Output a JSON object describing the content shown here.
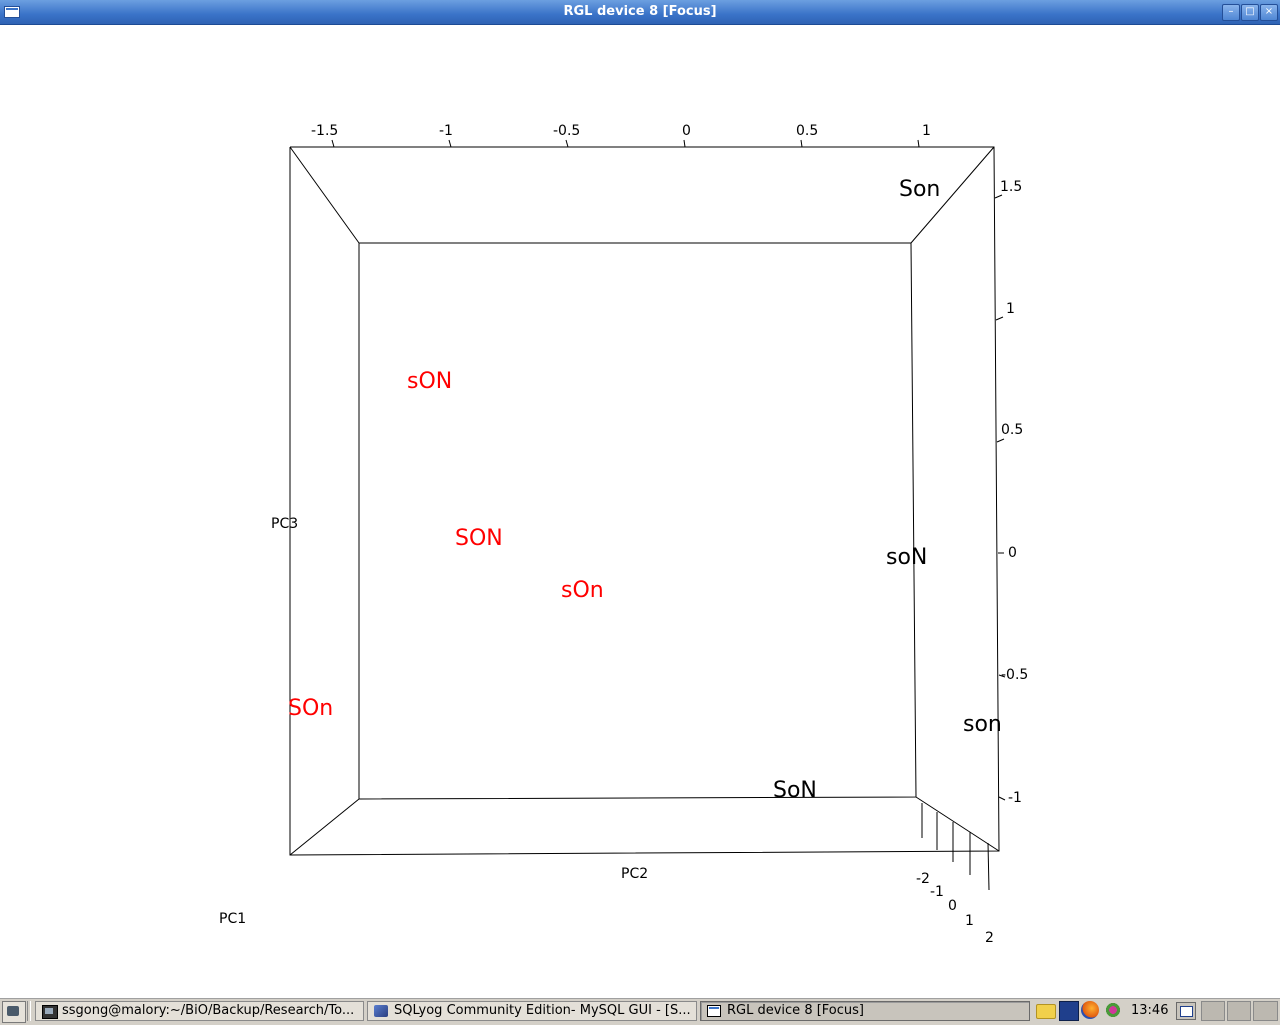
{
  "window": {
    "title": "RGL device 8 [Focus]",
    "buttons": {
      "minimize": "–",
      "maximize": "□",
      "close": "×"
    }
  },
  "plot": {
    "axes": {
      "pc1_label": "PC1",
      "pc2_label": "PC2",
      "pc3_label": "PC3",
      "top_ticks": [
        "-1.5",
        "-1",
        "-0.5",
        "0",
        "0.5",
        "1"
      ],
      "right_ticks": [
        "1.5",
        "1",
        "0.5",
        "0",
        "-0.5",
        "-1"
      ],
      "depth_ticks": [
        "-2",
        "-1",
        "0",
        "1",
        "2"
      ]
    },
    "points": [
      {
        "label": "Son",
        "color": "#000000"
      },
      {
        "label": "sON",
        "color": "#ff0000"
      },
      {
        "label": "SON",
        "color": "#ff0000"
      },
      {
        "label": "sOn",
        "color": "#ff0000"
      },
      {
        "label": "soN",
        "color": "#000000"
      },
      {
        "label": "SOn",
        "color": "#ff0000"
      },
      {
        "label": "son",
        "color": "#000000"
      },
      {
        "label": "SoN",
        "color": "#000000"
      }
    ]
  },
  "taskbar": {
    "tasks": [
      {
        "label": "ssgong@malory:~/BiO/Backup/Research/To...",
        "icon": "terminal-icon",
        "active": false
      },
      {
        "label": "SQLyog Community Edition- MySQL GUI - [S...",
        "icon": "sqlyog-icon",
        "active": false
      },
      {
        "label": "RGL device 8 [Focus]",
        "icon": "window-icon",
        "active": true
      }
    ],
    "tray_icons": [
      "folder-icon",
      "monitor-icon",
      "firefox-icon",
      "settings-icon"
    ],
    "clock": "13:46"
  }
}
